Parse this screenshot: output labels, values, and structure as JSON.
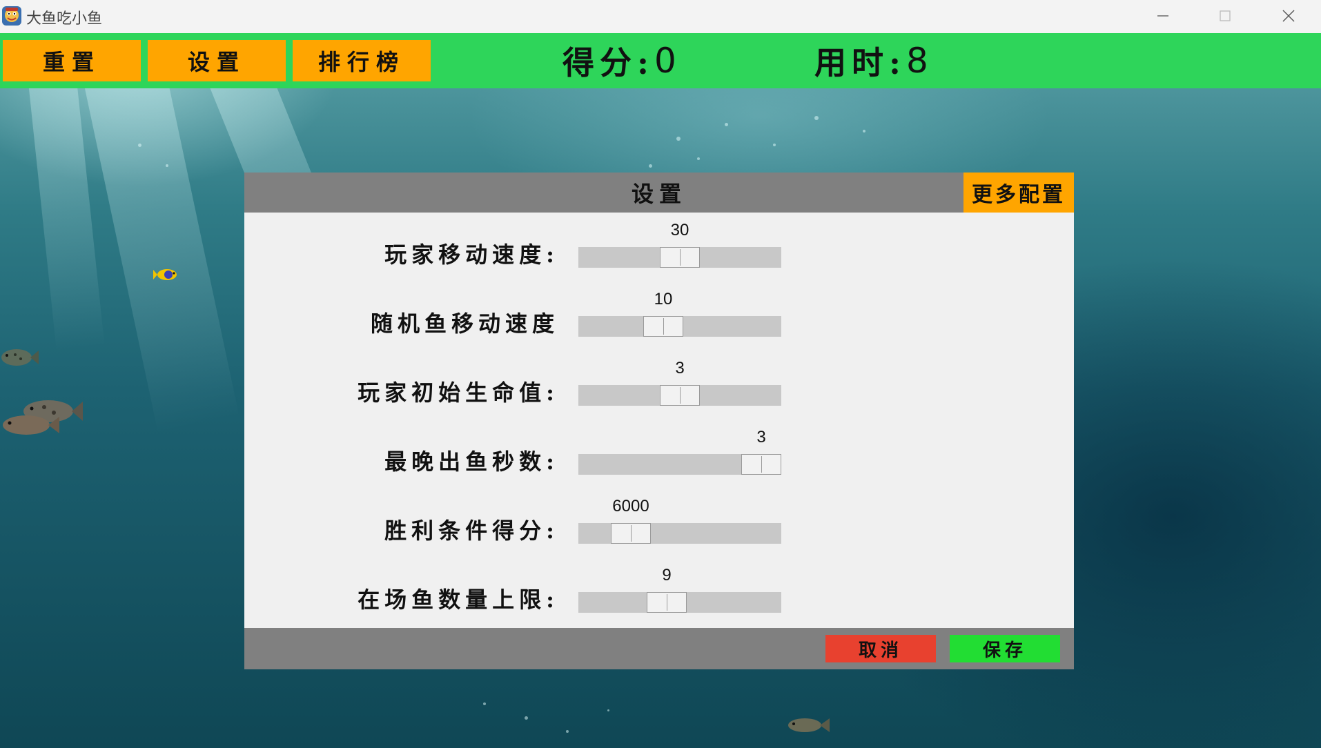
{
  "window": {
    "title": "大鱼吃小鱼",
    "icon": "fish-app-icon",
    "controls": [
      "minimize-icon",
      "maximize-icon",
      "close-icon"
    ]
  },
  "toolbar": {
    "reset_label": "重置",
    "settings_label": "设置",
    "leaderboard_label": "排行榜",
    "score_label": "得分:",
    "score_value": "0",
    "time_label": "用时:",
    "time_value": "8",
    "bg_color": "#2ed55a",
    "button_color": "#ffa500"
  },
  "settings_dialog": {
    "title": "设置",
    "more_config_label": "更多配置",
    "rows": [
      {
        "label": "玩家移动速度:",
        "value": "30",
        "level": 0.5
      },
      {
        "label": "随机鱼移动速度",
        "value": "10",
        "level": 0.4
      },
      {
        "label": "玩家初始生命值:",
        "value": "3",
        "level": 0.5
      },
      {
        "label": "最晚出鱼秒数:",
        "value": "3",
        "level": 1.0
      },
      {
        "label": "胜利条件得分:",
        "value": "6000",
        "level": 0.2
      },
      {
        "label": "在场鱼数量上限:",
        "value": "9",
        "level": 0.42
      }
    ],
    "cancel_label": "取消",
    "save_label": "保存",
    "cancel_color": "#e8412f",
    "save_color": "#22dd33",
    "header_color": "#808080"
  }
}
